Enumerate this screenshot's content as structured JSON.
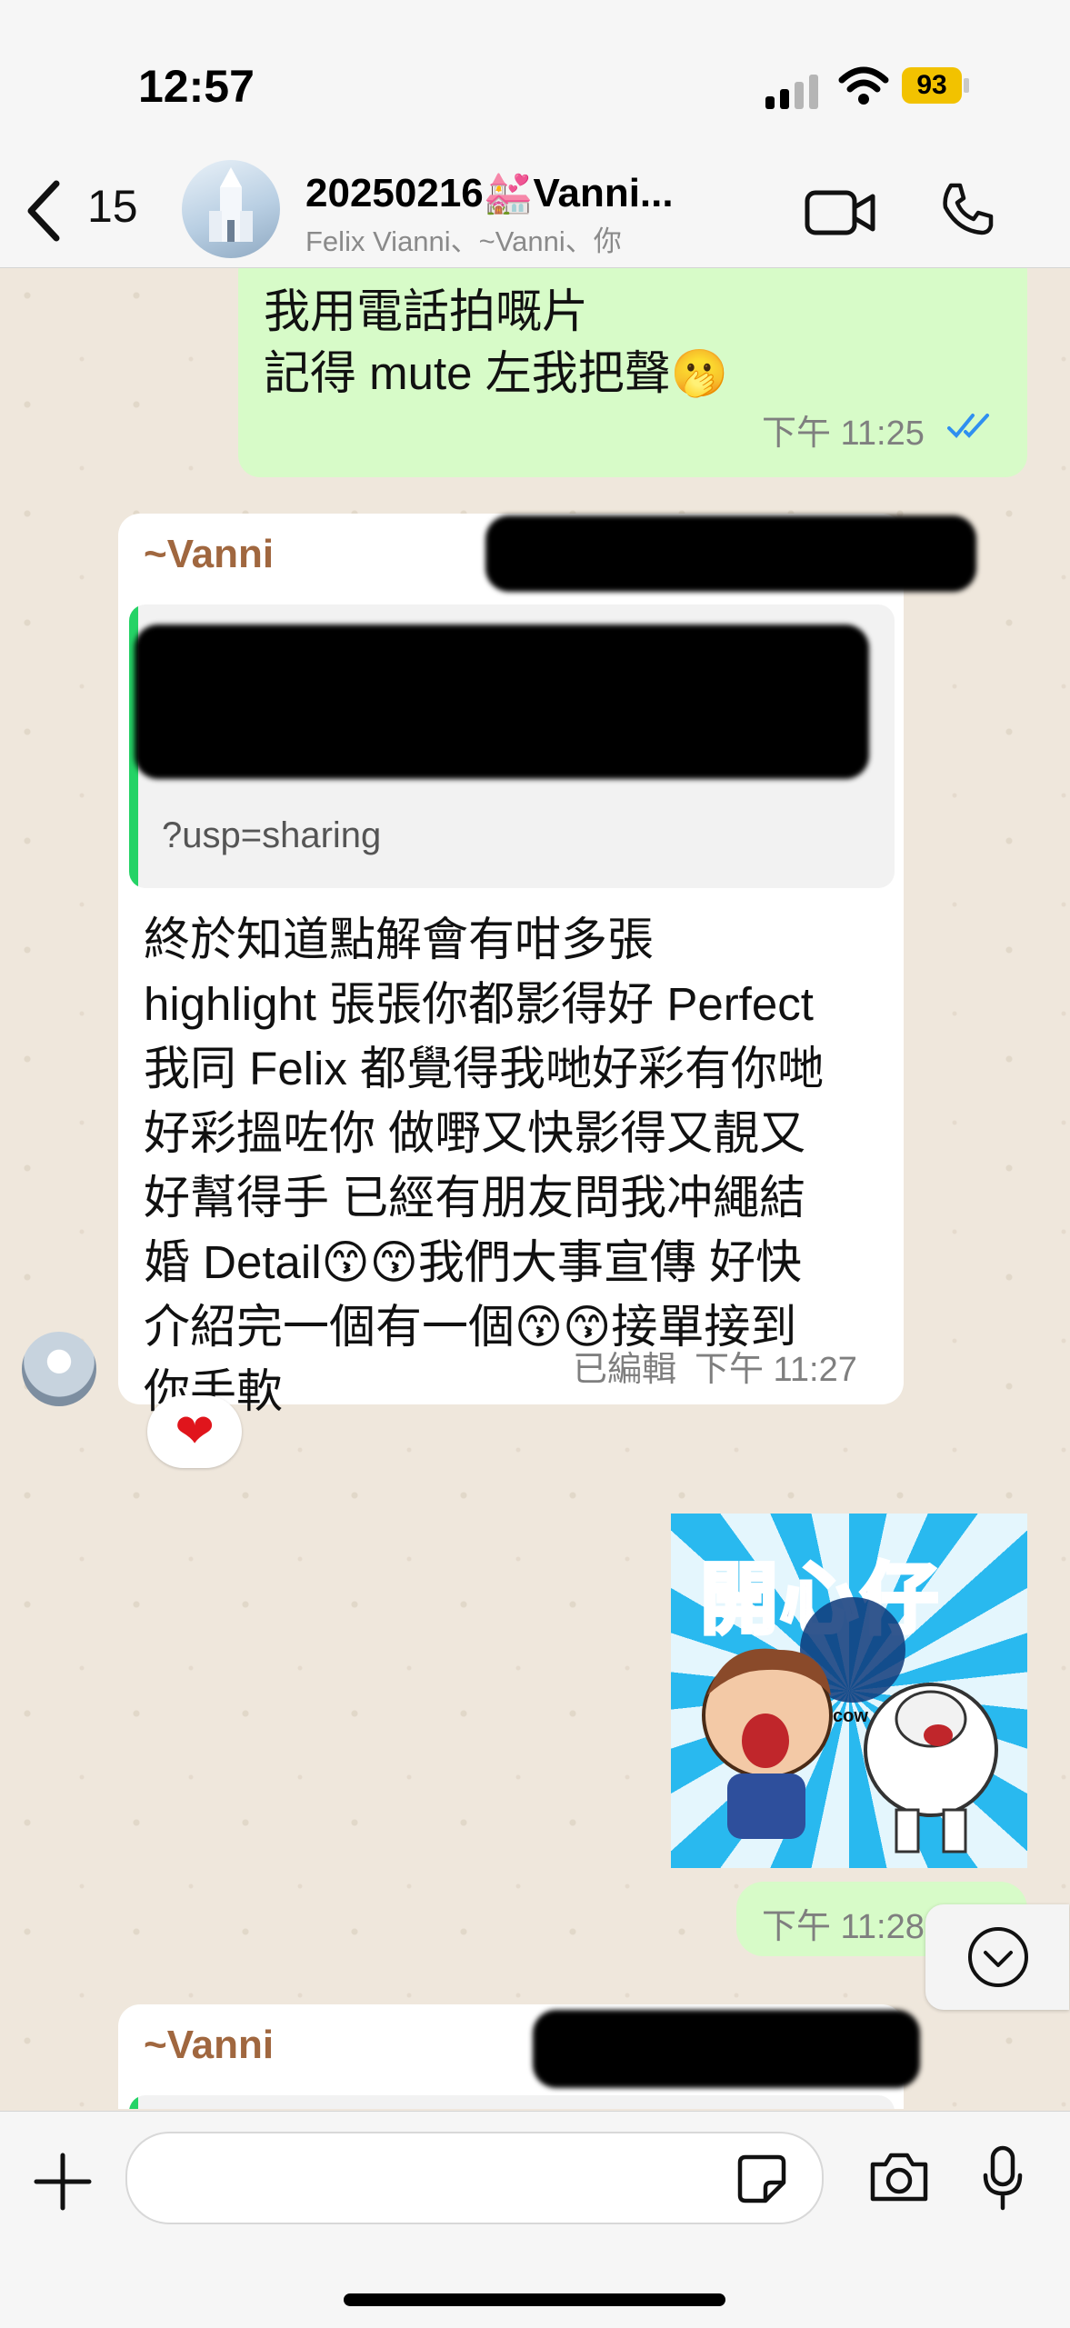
{
  "status_bar": {
    "time": "12:57",
    "battery": "93"
  },
  "header": {
    "back_count": "15",
    "title": "20250216💒Vanni...",
    "subtitle": "Felix Vianni、~Vanni、你"
  },
  "messages": {
    "out1": {
      "text": "我用電話拍嘅片\n記得 mute 左我把聲🫢",
      "time": "下午 11:25"
    },
    "in1": {
      "sender": "~Vanni",
      "link_tail": "?usp=sharing",
      "text": "終於知道點解會有咁多張\n highlight 張張你都影得好 Perfect\n我同 Felix 都覺得我哋好彩有你哋\n好彩搵咗你 做嘢又快影得又靚又\n好幫得手 已經有朋友問我冲繩結\n婚 Detail😙😙我們大事宣傳 好快\n介紹完一個有一個😙😙接單接到\n你手軟",
      "edited": "已編輯",
      "time": "下午 11:27",
      "reaction": "❤"
    },
    "sticker": {
      "title": "開心仔",
      "label": "cow",
      "time": "下午 11:28"
    },
    "in2": {
      "sender": "~Vanni"
    }
  },
  "composer": {
    "placeholder": ""
  }
}
